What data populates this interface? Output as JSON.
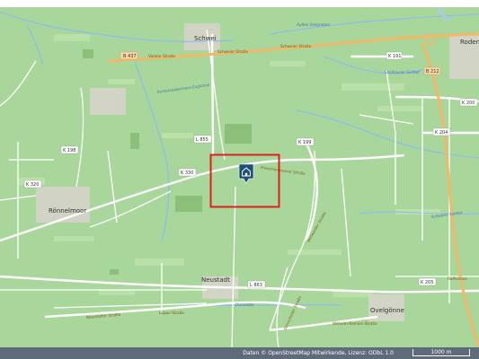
{
  "map": {
    "places": [
      "Schwei",
      "Rodenk",
      "Rönnelmoor",
      "Neustadt",
      "Ovelgönne"
    ],
    "roads": {
      "vareler": "Vareler Straße",
      "schweier1": "Schweier Straße",
      "schweier2": "Schweier Straße",
      "frieschenmoorer": "Frieschenmoorer Straße",
      "boitwarder": "Boitwarder Straße",
      "neustadter": "Neustädter Straße",
      "conneforder": "Conneforder Straße",
      "wilhelm": "Wilhelm-Ramien-Straße",
      "loeppo": "Löppo Straße",
      "raffeiseon": "Raffeiseon"
    },
    "waters": {
      "aussentief": "Außen Sielgraben",
      "kanal": "Achterstadermoor-Zugkanal",
      "strohauser": "Strohauser Sieltief",
      "schweier_sieltief": "Schweier Sieltief",
      "dornebbe": "Dornebbe"
    },
    "shields": {
      "b437": "B 437",
      "k191": "K 191",
      "b212": "B 212",
      "k200": "K 200",
      "k204": "K 204",
      "k198": "K 198",
      "l855": "L 855",
      "k199": "K 199",
      "k330a": "K 330",
      "k320": "K 320",
      "l863": "L 863",
      "k205": "K 205"
    },
    "colors": {
      "land": "#a6d58f",
      "road": "#ffffff",
      "major_road": "#f4c27e",
      "highlight": "#e02020",
      "marker": "#1f4e79",
      "water": "#aacbee"
    },
    "marker_icon": "house-icon"
  },
  "footer": {
    "attribution": "Daten © OpenStreetMap Mitwirkende, Lizenz: ODbL 1.0",
    "scale": "1000 m"
  }
}
